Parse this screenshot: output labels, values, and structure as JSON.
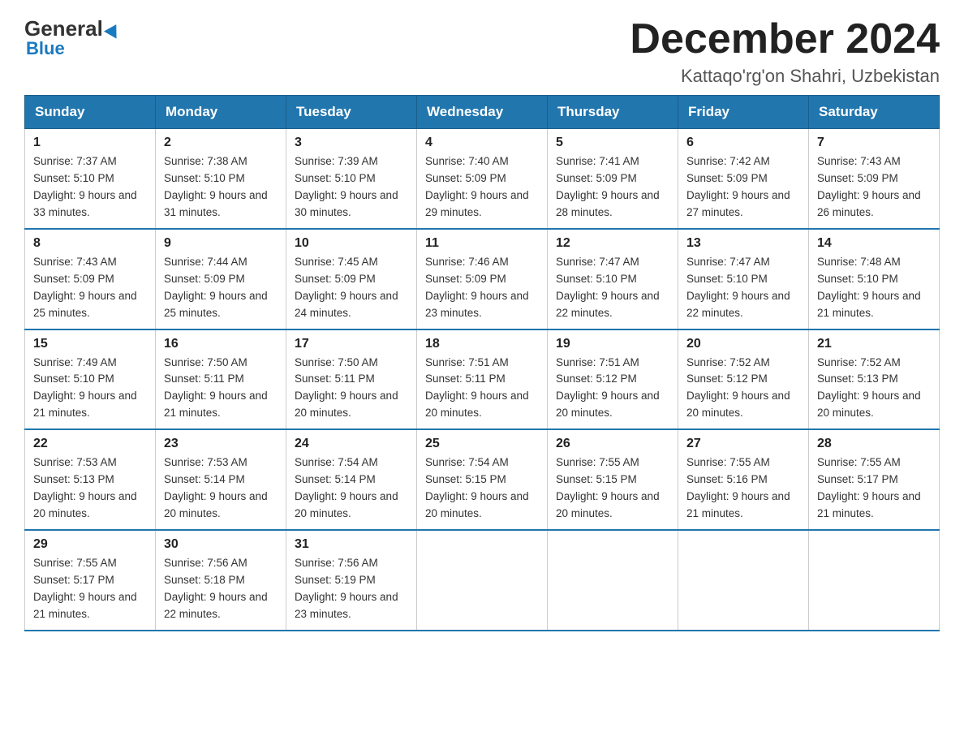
{
  "logo": {
    "general": "General",
    "blue_text": "Blue",
    "triangle_char": "▶"
  },
  "header": {
    "month_year": "December 2024",
    "location": "Kattaqo'rg'on Shahri, Uzbekistan"
  },
  "weekdays": [
    "Sunday",
    "Monday",
    "Tuesday",
    "Wednesday",
    "Thursday",
    "Friday",
    "Saturday"
  ],
  "weeks": [
    [
      {
        "day": "1",
        "sunrise": "7:37 AM",
        "sunset": "5:10 PM",
        "daylight": "9 hours and 33 minutes."
      },
      {
        "day": "2",
        "sunrise": "7:38 AM",
        "sunset": "5:10 PM",
        "daylight": "9 hours and 31 minutes."
      },
      {
        "day": "3",
        "sunrise": "7:39 AM",
        "sunset": "5:10 PM",
        "daylight": "9 hours and 30 minutes."
      },
      {
        "day": "4",
        "sunrise": "7:40 AM",
        "sunset": "5:09 PM",
        "daylight": "9 hours and 29 minutes."
      },
      {
        "day": "5",
        "sunrise": "7:41 AM",
        "sunset": "5:09 PM",
        "daylight": "9 hours and 28 minutes."
      },
      {
        "day": "6",
        "sunrise": "7:42 AM",
        "sunset": "5:09 PM",
        "daylight": "9 hours and 27 minutes."
      },
      {
        "day": "7",
        "sunrise": "7:43 AM",
        "sunset": "5:09 PM",
        "daylight": "9 hours and 26 minutes."
      }
    ],
    [
      {
        "day": "8",
        "sunrise": "7:43 AM",
        "sunset": "5:09 PM",
        "daylight": "9 hours and 25 minutes."
      },
      {
        "day": "9",
        "sunrise": "7:44 AM",
        "sunset": "5:09 PM",
        "daylight": "9 hours and 25 minutes."
      },
      {
        "day": "10",
        "sunrise": "7:45 AM",
        "sunset": "5:09 PM",
        "daylight": "9 hours and 24 minutes."
      },
      {
        "day": "11",
        "sunrise": "7:46 AM",
        "sunset": "5:09 PM",
        "daylight": "9 hours and 23 minutes."
      },
      {
        "day": "12",
        "sunrise": "7:47 AM",
        "sunset": "5:10 PM",
        "daylight": "9 hours and 22 minutes."
      },
      {
        "day": "13",
        "sunrise": "7:47 AM",
        "sunset": "5:10 PM",
        "daylight": "9 hours and 22 minutes."
      },
      {
        "day": "14",
        "sunrise": "7:48 AM",
        "sunset": "5:10 PM",
        "daylight": "9 hours and 21 minutes."
      }
    ],
    [
      {
        "day": "15",
        "sunrise": "7:49 AM",
        "sunset": "5:10 PM",
        "daylight": "9 hours and 21 minutes."
      },
      {
        "day": "16",
        "sunrise": "7:50 AM",
        "sunset": "5:11 PM",
        "daylight": "9 hours and 21 minutes."
      },
      {
        "day": "17",
        "sunrise": "7:50 AM",
        "sunset": "5:11 PM",
        "daylight": "9 hours and 20 minutes."
      },
      {
        "day": "18",
        "sunrise": "7:51 AM",
        "sunset": "5:11 PM",
        "daylight": "9 hours and 20 minutes."
      },
      {
        "day": "19",
        "sunrise": "7:51 AM",
        "sunset": "5:12 PM",
        "daylight": "9 hours and 20 minutes."
      },
      {
        "day": "20",
        "sunrise": "7:52 AM",
        "sunset": "5:12 PM",
        "daylight": "9 hours and 20 minutes."
      },
      {
        "day": "21",
        "sunrise": "7:52 AM",
        "sunset": "5:13 PM",
        "daylight": "9 hours and 20 minutes."
      }
    ],
    [
      {
        "day": "22",
        "sunrise": "7:53 AM",
        "sunset": "5:13 PM",
        "daylight": "9 hours and 20 minutes."
      },
      {
        "day": "23",
        "sunrise": "7:53 AM",
        "sunset": "5:14 PM",
        "daylight": "9 hours and 20 minutes."
      },
      {
        "day": "24",
        "sunrise": "7:54 AM",
        "sunset": "5:14 PM",
        "daylight": "9 hours and 20 minutes."
      },
      {
        "day": "25",
        "sunrise": "7:54 AM",
        "sunset": "5:15 PM",
        "daylight": "9 hours and 20 minutes."
      },
      {
        "day": "26",
        "sunrise": "7:55 AM",
        "sunset": "5:15 PM",
        "daylight": "9 hours and 20 minutes."
      },
      {
        "day": "27",
        "sunrise": "7:55 AM",
        "sunset": "5:16 PM",
        "daylight": "9 hours and 21 minutes."
      },
      {
        "day": "28",
        "sunrise": "7:55 AM",
        "sunset": "5:17 PM",
        "daylight": "9 hours and 21 minutes."
      }
    ],
    [
      {
        "day": "29",
        "sunrise": "7:55 AM",
        "sunset": "5:17 PM",
        "daylight": "9 hours and 21 minutes."
      },
      {
        "day": "30",
        "sunrise": "7:56 AM",
        "sunset": "5:18 PM",
        "daylight": "9 hours and 22 minutes."
      },
      {
        "day": "31",
        "sunrise": "7:56 AM",
        "sunset": "5:19 PM",
        "daylight": "9 hours and 23 minutes."
      },
      null,
      null,
      null,
      null
    ]
  ]
}
